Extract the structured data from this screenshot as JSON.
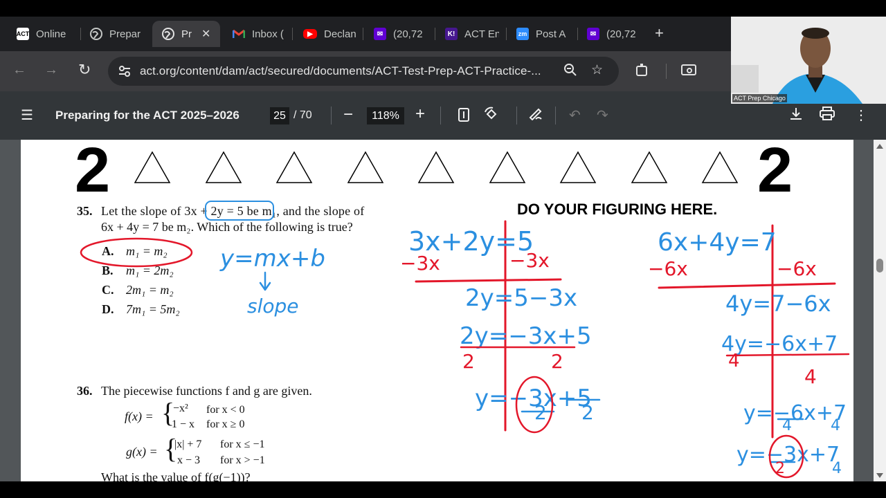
{
  "tabs": [
    {
      "label": "Online",
      "icon": "act-icon"
    },
    {
      "label": "Prepar",
      "icon": "globe-icon"
    },
    {
      "label": "Pr",
      "icon": "globe-icon"
    },
    {
      "label": "Inbox (",
      "icon": "gmail-icon"
    },
    {
      "label": "Declan",
      "icon": "youtube-icon"
    },
    {
      "label": "(20,72",
      "icon": "yahoo-mail-icon"
    },
    {
      "label": "ACT En",
      "icon": "kahoot-icon"
    },
    {
      "label": "Post A",
      "icon": "zoom-icon"
    },
    {
      "label": "(20,72",
      "icon": "yahoo-mail-icon"
    }
  ],
  "browser": {
    "url": "act.org/content/dam/act/secured/documents/ACT-Test-Prep-ACT-Practice-..."
  },
  "pdf": {
    "title": "Preparing for the ACT 2025–2026",
    "page": "25",
    "total": "/ 70",
    "zoom": "118%"
  },
  "doc": {
    "section": "2",
    "figuring": "DO YOUR FIGURING HERE.",
    "q35_num": "35.",
    "q35_line1": "Let the slope of 3x + 2y = 5 be m₁, and the slope of",
    "q35_line2": "6x + 4y = 7 be m₂. Which of the following is true?",
    "q35_choices": [
      {
        "letter": "A.",
        "text": "m₁ = m₂"
      },
      {
        "letter": "B.",
        "text": "m₁ = 2m₂"
      },
      {
        "letter": "C.",
        "text": "2m₁ = m₂"
      },
      {
        "letter": "D.",
        "text": "7m₁ = 5m₂"
      }
    ],
    "q36_num": "36.",
    "q36_line1": "The piecewise functions f and g are given.",
    "f_label": "f(x) =",
    "f_rows": [
      [
        "−x²",
        "for x < 0"
      ],
      [
        "1 − x",
        "for x ≥ 0"
      ]
    ],
    "g_label": "g(x) =",
    "g_rows": [
      [
        "|x| + 7",
        "for x ≤ −1"
      ],
      [
        "x − 3",
        "for x > −1"
      ]
    ],
    "q36_line2": "What is the value of f(g(−1))?"
  },
  "handwriting": {
    "left": [
      "y = mx + b",
      "slope"
    ],
    "mid": [
      "3x + 2y = 5",
      "−3x",
      "−3x",
      "2y = 5 − 3x",
      "2y = −3x + 5",
      "2",
      "2",
      "y = −3x/2 + 5/2"
    ],
    "right": [
      "6x + 4y = 7",
      "−6x",
      "−6x",
      "4y = 7 − 6x",
      "4y = −6x + 7",
      "4",
      "4",
      "y = −6x/4 + 7/4",
      "y = −3x/2 + 7/4"
    ]
  },
  "webcam": {
    "label": "ACT Prep Chicago"
  },
  "colors": {
    "ink_blue": "#2b8fe0",
    "ink_red": "#e3172a"
  }
}
